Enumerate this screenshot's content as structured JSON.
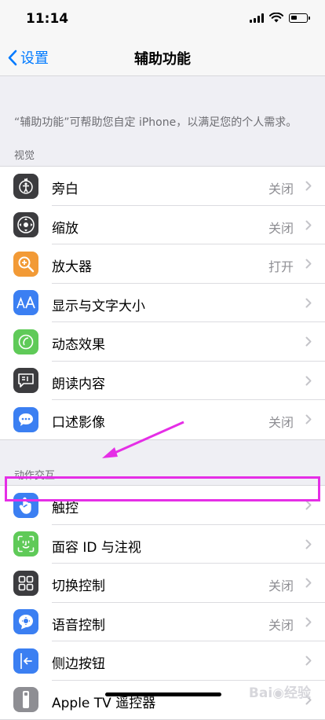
{
  "status": {
    "time": "11:14"
  },
  "nav": {
    "back_label": "设置",
    "title": "辅助功能"
  },
  "description": "“辅助功能”可帮助您自定 iPhone，以满足您的个人需求。",
  "sections": {
    "vision": {
      "header": "视觉",
      "items": [
        {
          "label": "旁白",
          "value": "关闭",
          "icon": "voiceover-icon",
          "color": "#3c3c3f"
        },
        {
          "label": "缩放",
          "value": "关闭",
          "icon": "zoom-icon",
          "color": "#3c3c3f"
        },
        {
          "label": "放大器",
          "value": "打开",
          "icon": "magnifier-icon",
          "color": "#f29a36"
        },
        {
          "label": "显示与文字大小",
          "value": "",
          "icon": "text-size-icon",
          "color": "#3b7ff2"
        },
        {
          "label": "动态效果",
          "value": "",
          "icon": "motion-icon",
          "color": "#5fca58"
        },
        {
          "label": "朗读内容",
          "value": "",
          "icon": "spoken-content-icon",
          "color": "#3c3c3f"
        },
        {
          "label": "口述影像",
          "value": "关闭",
          "icon": "audio-description-icon",
          "color": "#3b7ff2"
        }
      ]
    },
    "interaction": {
      "header": "动作交互",
      "items": [
        {
          "label": "触控",
          "value": "",
          "icon": "touch-icon",
          "color": "#3b7ff2"
        },
        {
          "label": "面容 ID 与注视",
          "value": "",
          "icon": "face-id-icon",
          "color": "#5fca58"
        },
        {
          "label": "切换控制",
          "value": "关闭",
          "icon": "switch-control-icon",
          "color": "#3c3c3f"
        },
        {
          "label": "语音控制",
          "value": "关闭",
          "icon": "voice-control-icon",
          "color": "#3b7ff2"
        },
        {
          "label": "侧边按钮",
          "value": "",
          "icon": "side-button-icon",
          "color": "#3b7ff2"
        },
        {
          "label": "Apple TV 遥控器",
          "value": "",
          "icon": "apple-tv-remote-icon",
          "color": "#8e8e93"
        }
      ]
    }
  },
  "colors": {
    "accent": "#007aff",
    "annotation": "#e52ee6"
  }
}
